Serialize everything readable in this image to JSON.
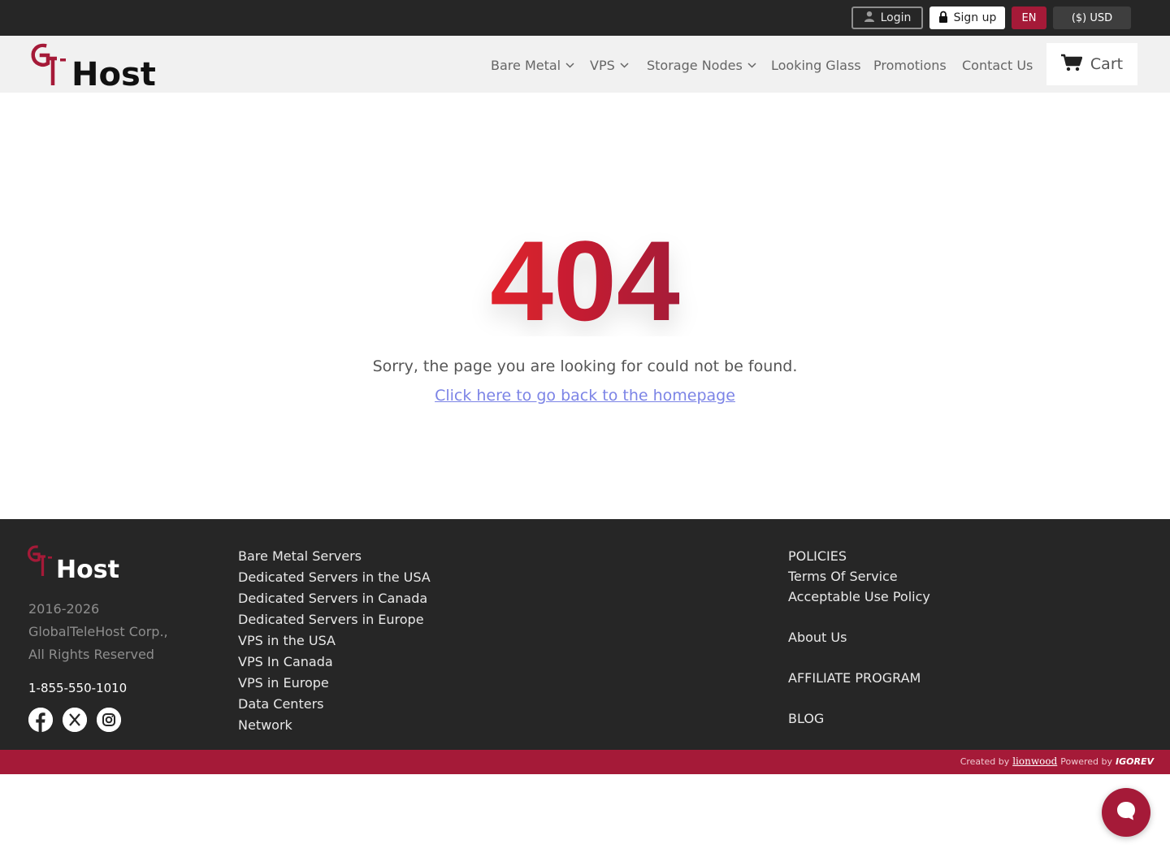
{
  "topbar": {
    "login_label": "Login",
    "signup_label": "Sign up",
    "language": "EN",
    "currency": "($) USD"
  },
  "header": {
    "logo_text": "Host",
    "nav": [
      {
        "label": "Bare Metal",
        "has_dropdown": true
      },
      {
        "label": "VPS",
        "has_dropdown": true
      },
      {
        "label": "Storage Nodes",
        "has_dropdown": true
      },
      {
        "label": "Looking Glass",
        "has_dropdown": false
      },
      {
        "label": "Promotions",
        "has_dropdown": false
      },
      {
        "label": "Contact Us",
        "has_dropdown": false
      }
    ],
    "cart_label": "Cart"
  },
  "error": {
    "code": "404",
    "message": "Sorry, the page you are looking for could not be found.",
    "home_link": "Click here to go back to the homepage"
  },
  "footer": {
    "logo_text": "Host",
    "copyright_years": "2016-2026",
    "company": "GlobalTeleHost Corp.,",
    "rights": "All Rights Reserved",
    "phone": "1-855-550-1010",
    "social_icons": [
      "facebook-icon",
      "x-icon",
      "instagram-icon"
    ],
    "col1": [
      "Bare Metal Servers",
      "Dedicated Servers in the USA",
      "Dedicated Servers in Canada",
      "Dedicated Servers in Europe",
      "VPS in the USA",
      "VPS In Canada",
      "VPS in Europe",
      "Data Centers",
      "Network"
    ],
    "policies_heading": "POLICIES",
    "terms": "Terms Of Service",
    "aup": "Acceptable Use Policy",
    "about": "About Us",
    "affiliate": "AFFILIATE PROGRAM",
    "blog": "BLOG"
  },
  "credit": {
    "created_by": "Created by",
    "creator": "lionwood",
    "powered_by": "Powered by",
    "powerer": "IGOREV"
  },
  "colors": {
    "brand_red": "#a51a38",
    "error_gradient_start": "#e0222c",
    "error_gradient_end": "#a51a38",
    "dark": "#262626",
    "link": "#7c84e6"
  }
}
